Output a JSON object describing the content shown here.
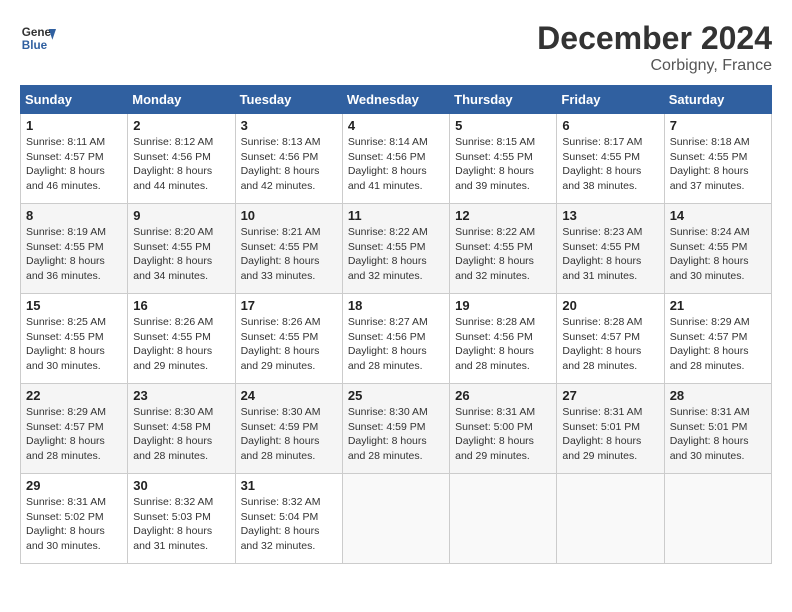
{
  "header": {
    "logo_line1": "General",
    "logo_line2": "Blue",
    "month": "December 2024",
    "location": "Corbigny, France"
  },
  "weekdays": [
    "Sunday",
    "Monday",
    "Tuesday",
    "Wednesday",
    "Thursday",
    "Friday",
    "Saturday"
  ],
  "weeks": [
    [
      {
        "day": "1",
        "sunrise": "Sunrise: 8:11 AM",
        "sunset": "Sunset: 4:57 PM",
        "daylight": "Daylight: 8 hours and 46 minutes."
      },
      {
        "day": "2",
        "sunrise": "Sunrise: 8:12 AM",
        "sunset": "Sunset: 4:56 PM",
        "daylight": "Daylight: 8 hours and 44 minutes."
      },
      {
        "day": "3",
        "sunrise": "Sunrise: 8:13 AM",
        "sunset": "Sunset: 4:56 PM",
        "daylight": "Daylight: 8 hours and 42 minutes."
      },
      {
        "day": "4",
        "sunrise": "Sunrise: 8:14 AM",
        "sunset": "Sunset: 4:56 PM",
        "daylight": "Daylight: 8 hours and 41 minutes."
      },
      {
        "day": "5",
        "sunrise": "Sunrise: 8:15 AM",
        "sunset": "Sunset: 4:55 PM",
        "daylight": "Daylight: 8 hours and 39 minutes."
      },
      {
        "day": "6",
        "sunrise": "Sunrise: 8:17 AM",
        "sunset": "Sunset: 4:55 PM",
        "daylight": "Daylight: 8 hours and 38 minutes."
      },
      {
        "day": "7",
        "sunrise": "Sunrise: 8:18 AM",
        "sunset": "Sunset: 4:55 PM",
        "daylight": "Daylight: 8 hours and 37 minutes."
      }
    ],
    [
      {
        "day": "8",
        "sunrise": "Sunrise: 8:19 AM",
        "sunset": "Sunset: 4:55 PM",
        "daylight": "Daylight: 8 hours and 36 minutes."
      },
      {
        "day": "9",
        "sunrise": "Sunrise: 8:20 AM",
        "sunset": "Sunset: 4:55 PM",
        "daylight": "Daylight: 8 hours and 34 minutes."
      },
      {
        "day": "10",
        "sunrise": "Sunrise: 8:21 AM",
        "sunset": "Sunset: 4:55 PM",
        "daylight": "Daylight: 8 hours and 33 minutes."
      },
      {
        "day": "11",
        "sunrise": "Sunrise: 8:22 AM",
        "sunset": "Sunset: 4:55 PM",
        "daylight": "Daylight: 8 hours and 32 minutes."
      },
      {
        "day": "12",
        "sunrise": "Sunrise: 8:22 AM",
        "sunset": "Sunset: 4:55 PM",
        "daylight": "Daylight: 8 hours and 32 minutes."
      },
      {
        "day": "13",
        "sunrise": "Sunrise: 8:23 AM",
        "sunset": "Sunset: 4:55 PM",
        "daylight": "Daylight: 8 hours and 31 minutes."
      },
      {
        "day": "14",
        "sunrise": "Sunrise: 8:24 AM",
        "sunset": "Sunset: 4:55 PM",
        "daylight": "Daylight: 8 hours and 30 minutes."
      }
    ],
    [
      {
        "day": "15",
        "sunrise": "Sunrise: 8:25 AM",
        "sunset": "Sunset: 4:55 PM",
        "daylight": "Daylight: 8 hours and 30 minutes."
      },
      {
        "day": "16",
        "sunrise": "Sunrise: 8:26 AM",
        "sunset": "Sunset: 4:55 PM",
        "daylight": "Daylight: 8 hours and 29 minutes."
      },
      {
        "day": "17",
        "sunrise": "Sunrise: 8:26 AM",
        "sunset": "Sunset: 4:55 PM",
        "daylight": "Daylight: 8 hours and 29 minutes."
      },
      {
        "day": "18",
        "sunrise": "Sunrise: 8:27 AM",
        "sunset": "Sunset: 4:56 PM",
        "daylight": "Daylight: 8 hours and 28 minutes."
      },
      {
        "day": "19",
        "sunrise": "Sunrise: 8:28 AM",
        "sunset": "Sunset: 4:56 PM",
        "daylight": "Daylight: 8 hours and 28 minutes."
      },
      {
        "day": "20",
        "sunrise": "Sunrise: 8:28 AM",
        "sunset": "Sunset: 4:57 PM",
        "daylight": "Daylight: 8 hours and 28 minutes."
      },
      {
        "day": "21",
        "sunrise": "Sunrise: 8:29 AM",
        "sunset": "Sunset: 4:57 PM",
        "daylight": "Daylight: 8 hours and 28 minutes."
      }
    ],
    [
      {
        "day": "22",
        "sunrise": "Sunrise: 8:29 AM",
        "sunset": "Sunset: 4:57 PM",
        "daylight": "Daylight: 8 hours and 28 minutes."
      },
      {
        "day": "23",
        "sunrise": "Sunrise: 8:30 AM",
        "sunset": "Sunset: 4:58 PM",
        "daylight": "Daylight: 8 hours and 28 minutes."
      },
      {
        "day": "24",
        "sunrise": "Sunrise: 8:30 AM",
        "sunset": "Sunset: 4:59 PM",
        "daylight": "Daylight: 8 hours and 28 minutes."
      },
      {
        "day": "25",
        "sunrise": "Sunrise: 8:30 AM",
        "sunset": "Sunset: 4:59 PM",
        "daylight": "Daylight: 8 hours and 28 minutes."
      },
      {
        "day": "26",
        "sunrise": "Sunrise: 8:31 AM",
        "sunset": "Sunset: 5:00 PM",
        "daylight": "Daylight: 8 hours and 29 minutes."
      },
      {
        "day": "27",
        "sunrise": "Sunrise: 8:31 AM",
        "sunset": "Sunset: 5:01 PM",
        "daylight": "Daylight: 8 hours and 29 minutes."
      },
      {
        "day": "28",
        "sunrise": "Sunrise: 8:31 AM",
        "sunset": "Sunset: 5:01 PM",
        "daylight": "Daylight: 8 hours and 30 minutes."
      }
    ],
    [
      {
        "day": "29",
        "sunrise": "Sunrise: 8:31 AM",
        "sunset": "Sunset: 5:02 PM",
        "daylight": "Daylight: 8 hours and 30 minutes."
      },
      {
        "day": "30",
        "sunrise": "Sunrise: 8:32 AM",
        "sunset": "Sunset: 5:03 PM",
        "daylight": "Daylight: 8 hours and 31 minutes."
      },
      {
        "day": "31",
        "sunrise": "Sunrise: 8:32 AM",
        "sunset": "Sunset: 5:04 PM",
        "daylight": "Daylight: 8 hours and 32 minutes."
      },
      null,
      null,
      null,
      null
    ]
  ]
}
